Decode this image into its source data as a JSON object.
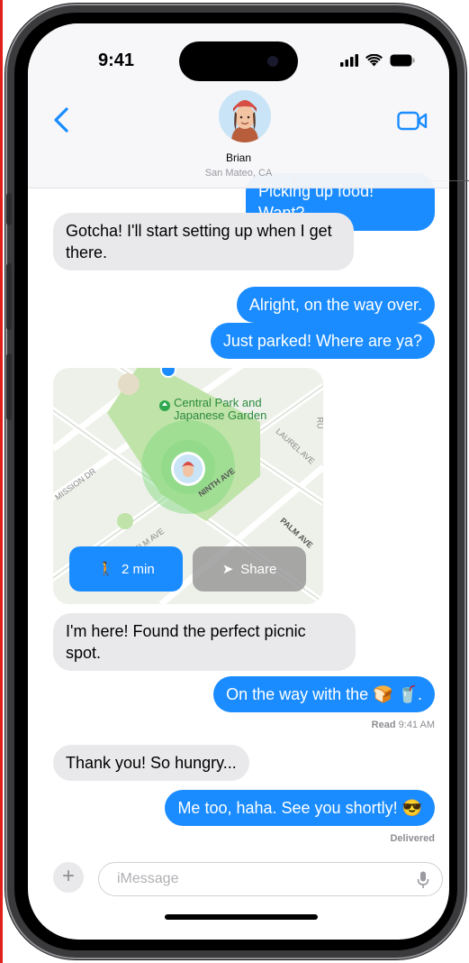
{
  "status": {
    "time": "9:41"
  },
  "contact": {
    "name": "Brian",
    "location": "San Mateo, CA"
  },
  "messages": [
    {
      "text": "Picking up food! Want?",
      "from": "me"
    },
    {
      "text": "Gotcha! I'll start setting up when I get there.",
      "from": "them"
    },
    {
      "text": "Alright, on the way over.",
      "from": "me"
    },
    {
      "text": "Just parked! Where are ya?",
      "from": "me"
    },
    {
      "text": "I'm here! Found the perfect picnic spot.",
      "from": "them"
    },
    {
      "text": "On the way with the 🍞 🥤.",
      "from": "me"
    },
    {
      "text": "Thank you! So hungry...",
      "from": "them"
    },
    {
      "text": "Me too, haha. See you shortly! 😎",
      "from": "me"
    }
  ],
  "receipts": {
    "read_label": "Read",
    "read_time": "9:41 AM",
    "delivered": "Delivered"
  },
  "map": {
    "park_label_1": "Central Park and",
    "park_label_2": "Japanese Garden",
    "streets": [
      "MISSION DR",
      "NINTH AVE",
      "LAUREL AVE",
      "PALM AVE",
      "ELM AVE",
      "RU"
    ],
    "walk_button": "2 min",
    "share_button": "Share"
  },
  "input": {
    "placeholder": "iMessage"
  },
  "colors": {
    "accent": "#1a8cff",
    "incoming": "#e9e9eb",
    "park": "#bfe3a8"
  }
}
